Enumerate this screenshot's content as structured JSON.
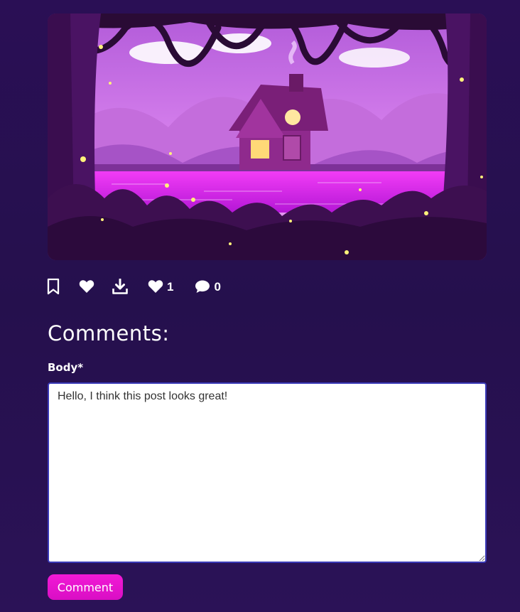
{
  "post": {
    "image_alt": "Illustration of a purple cottage by a glowing lake in a forest at night with fireflies"
  },
  "actions": {
    "likes_count": "1",
    "comments_count": "0"
  },
  "comments": {
    "heading": "Comments:",
    "body_label": "Body*",
    "body_value": "Hello, I think this post looks great! ",
    "submit_label": "Comment"
  },
  "colors": {
    "accent": "#e614cd",
    "background": "#2a0f55",
    "focus_border": "#3a3ab8"
  }
}
